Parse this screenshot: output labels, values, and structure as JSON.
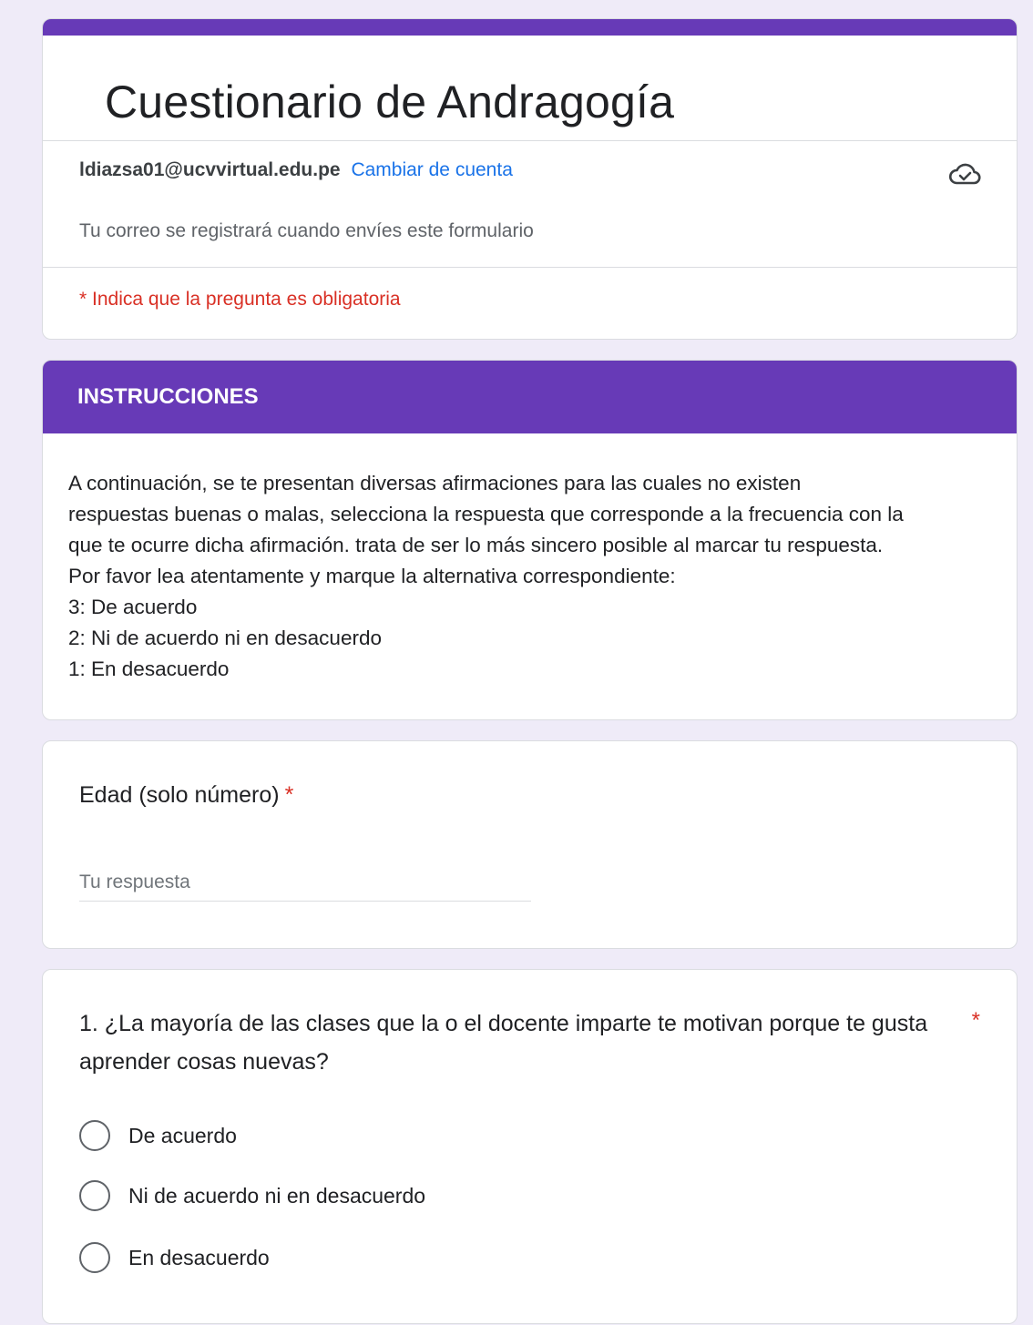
{
  "form": {
    "title": "Cuestionario de Andragogía",
    "accent_color": "#673ab7",
    "account_email": "ldiazsa01@ucvvirtual.edu.pe",
    "switch_account_label": "Cambiar de cuenta",
    "cloud_icon": "cloud-saved-icon",
    "record_note": "Tu correo se registrará cuando envíes este formulario",
    "required_note": "* Indica que la pregunta es obligatoria"
  },
  "instructions": {
    "header": "INSTRUCCIONES",
    "lines": [
      "A continuación, se te presentan diversas afirmaciones para las cuales no existen",
      "respuestas buenas o malas, selecciona la respuesta que corresponde a la frecuencia con la",
      "que te ocurre dicha afirmación. trata de ser lo más sincero posible al marcar tu respuesta.",
      "Por favor lea atentamente y marque la alternativa  correspondiente:",
      "3: De acuerdo",
      "2: Ni de acuerdo ni en desacuerdo",
      "1: En desacuerdo"
    ]
  },
  "age_question": {
    "title": "Edad (solo número)",
    "required_mark": "*",
    "placeholder": "Tu respuesta"
  },
  "question1": {
    "title": "1. ¿La mayoría de las clases que la o el docente imparte te motivan porque te gusta aprender cosas nuevas?",
    "required_mark": "*",
    "options": [
      "De acuerdo",
      "Ni de acuerdo ni en desacuerdo",
      "En desacuerdo"
    ]
  }
}
